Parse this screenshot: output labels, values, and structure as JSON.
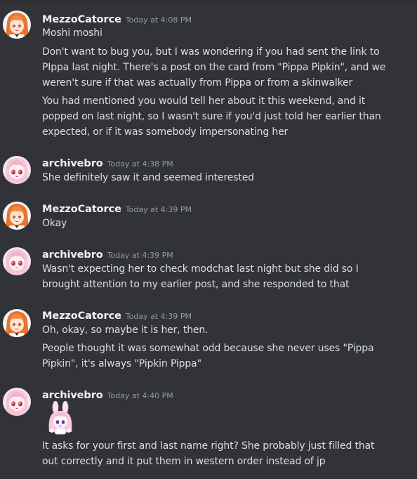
{
  "messages": [
    {
      "author": "MezzoCatorce",
      "time": "Today at 4:08 PM",
      "avatar_icon": "mezzo-avatar-icon",
      "lines": [
        "Moshi moshi",
        "Don't want to bug you, but I was wondering if you had sent the link to",
        "PIppa last night. There's a post on the card from \"Pippa Pipkin\", and we",
        "weren't sure if that was actually from Pippa or from a skinwalker",
        "You had mentioned you would tell her about it this weekend, and it",
        "popped on last night, so I wasn't sure if you'd just told her earlier than",
        "expected, or if it was somebody impersonating her"
      ]
    },
    {
      "author": "archivebro",
      "time": "Today at 4:38 PM",
      "avatar_icon": "archivebro-avatar-icon",
      "lines": [
        "She definitely saw it and seemed interested"
      ]
    },
    {
      "author": "MezzoCatorce",
      "time": "Today at 4:39 PM",
      "avatar_icon": "mezzo-avatar-icon",
      "lines": [
        "Okay"
      ]
    },
    {
      "author": "archivebro",
      "time": "Today at 4:39 PM",
      "avatar_icon": "archivebro-avatar-icon",
      "lines": [
        "Wasn't expecting her to check modchat last night but she did so I",
        "brought attention to my earlier post, and she responded to that"
      ]
    },
    {
      "author": "MezzoCatorce",
      "time": "Today at 4:39 PM",
      "avatar_icon": "mezzo-avatar-icon",
      "lines": [
        "Oh, okay, so maybe it is her, then.",
        "People thought it was somewhat odd because she never uses \"Pippa",
        "Pipkin\", it's always \"Pipkin Pippa\""
      ]
    },
    {
      "author": "archivebro",
      "time": "Today at 4:40 PM",
      "avatar_icon": "archivebro-avatar-icon",
      "sticker_icon": "anime-bunny-girl-sticker-icon",
      "lines": [
        "It asks for your first and last name right? She probably just filled that",
        "out correctly and it put them in western order instead of jp"
      ]
    }
  ],
  "colors": {
    "background": "#313338",
    "username": "#f2f3f5",
    "timestamp": "#949ba4",
    "text": "#dbdee1"
  }
}
